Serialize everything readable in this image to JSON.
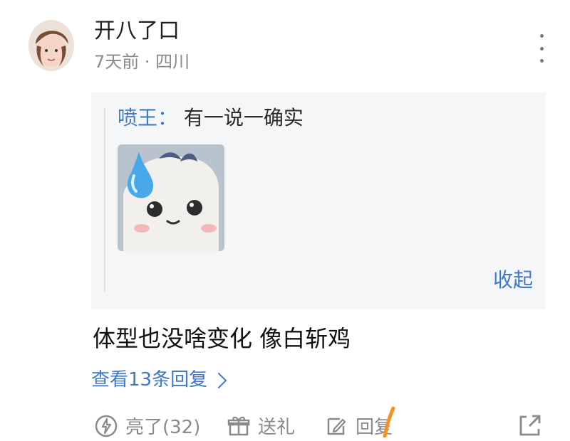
{
  "comment": {
    "username": "开八了口",
    "meta": "7天前 · 四川",
    "quote": {
      "author": "喷王：",
      "text": "有一说一确实",
      "collapse_label": "收起"
    },
    "content": "体型也没啥变化 像白斩鸡",
    "replies_label": "查看13条回复"
  },
  "actions": {
    "like_label": "亮了(32)",
    "gift_label": "送礼",
    "reply_label": "回复"
  },
  "icons": {
    "avatar": "avatar",
    "more": "more-vertical-icon",
    "sticker": "sticker-image",
    "like": "lightning-icon",
    "gift": "gift-icon",
    "reply": "edit-reply-icon",
    "share": "share-icon"
  },
  "colors": {
    "accent": "#3f78c8",
    "muted": "#8a8a8a",
    "quote_bg": "#f5f6f8",
    "mark": "#f7901e"
  }
}
